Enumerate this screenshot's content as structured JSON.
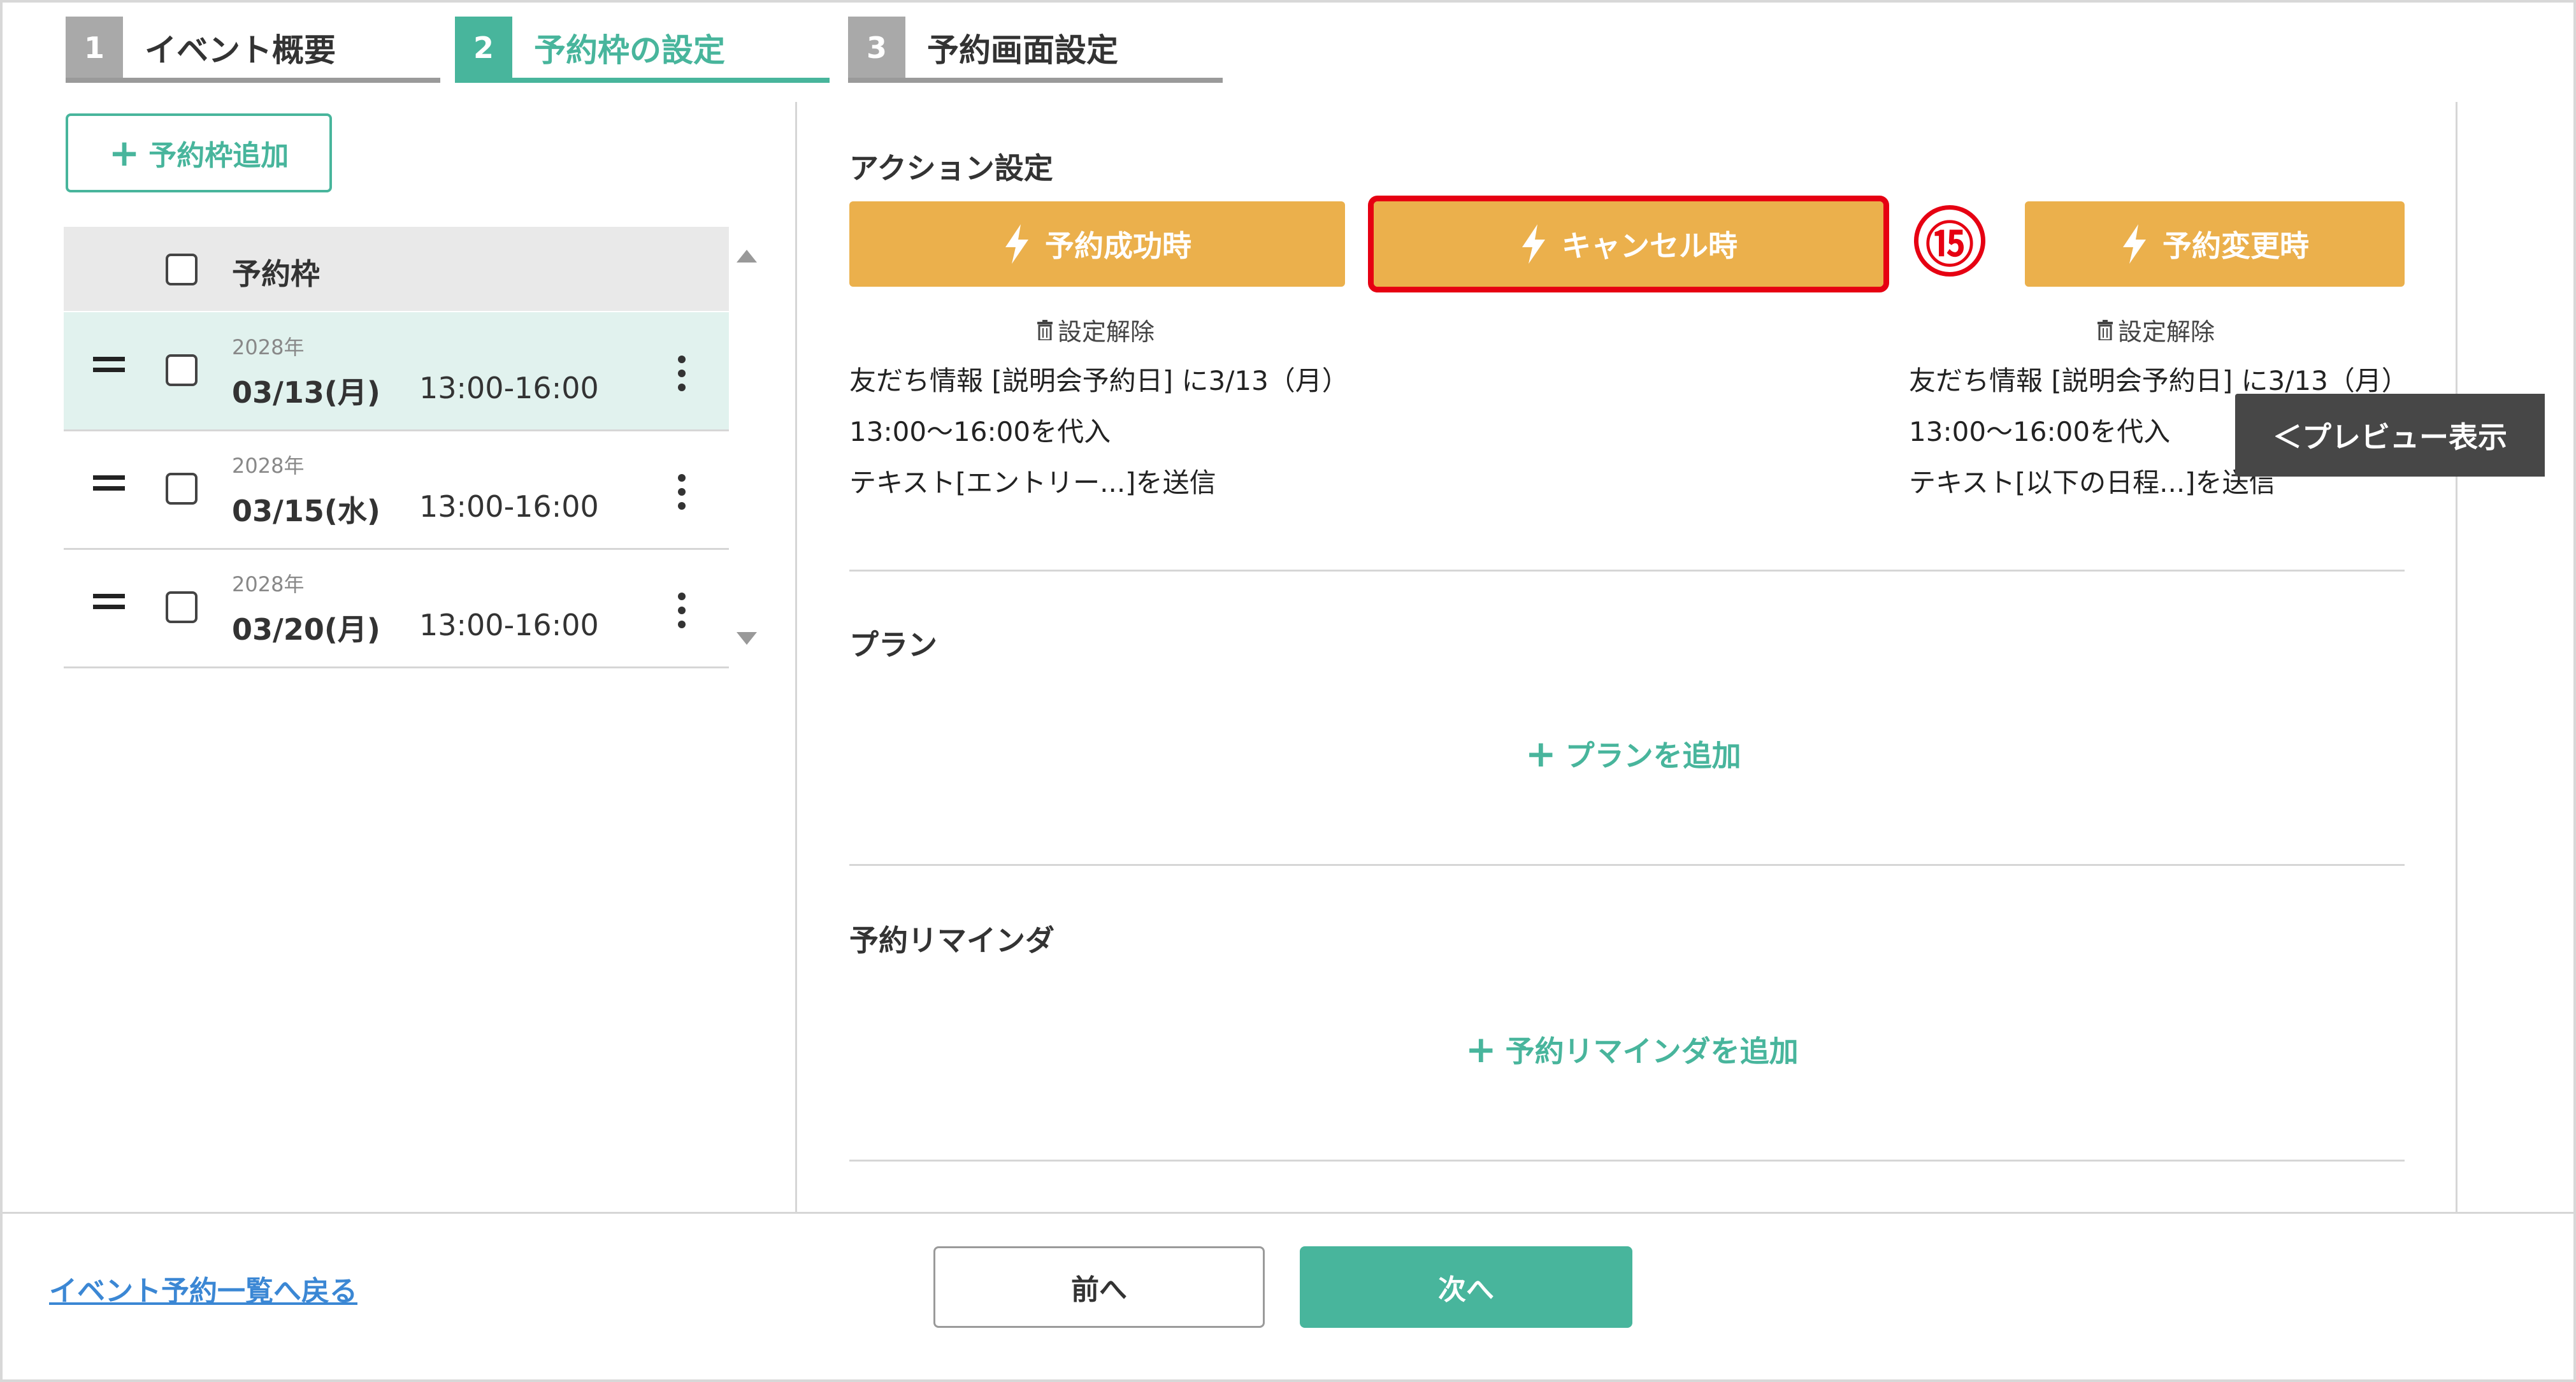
{
  "steps": [
    {
      "num": "1",
      "label": "イベント概要"
    },
    {
      "num": "2",
      "label": "予約枠の設定"
    },
    {
      "num": "3",
      "label": "予約画面設定"
    }
  ],
  "sidebar": {
    "add_slot_label": "予約枠追加",
    "list_header": "予約枠",
    "slots": [
      {
        "year": "2028年",
        "date": "03/13(月)",
        "time": "13:00-16:00"
      },
      {
        "year": "2028年",
        "date": "03/15(水)",
        "time": "13:00-16:00"
      },
      {
        "year": "2028年",
        "date": "03/20(月)",
        "time": "13:00-16:00"
      }
    ]
  },
  "actions": {
    "title": "アクション設定",
    "success_label": "予約成功時",
    "cancel_label": "キャンセル時",
    "change_label": "予約変更時",
    "annotation": "⑮",
    "unset_label": "設定解除",
    "success_desc": [
      "友だち情報 [説明会予約日] に3/13（月）",
      "13:00〜16:00を代入",
      "テキスト[エントリー...]を送信"
    ],
    "change_desc": [
      "友だち情報 [説明会予約日] に3/13（月）",
      "13:00〜16:00を代入",
      "テキスト[以下の日程...]を送信"
    ]
  },
  "plan": {
    "title": "プラン",
    "add_label": "プランを追加"
  },
  "reminder": {
    "title": "予約リマインダ",
    "add_label": "予約リマインダを追加"
  },
  "preview_label": "＜プレビュー表示",
  "footer": {
    "back_link": "イベント予約一覧へ戻る",
    "prev_label": "前へ",
    "next_label": "次へ"
  },
  "colors": {
    "accent": "#48b59c",
    "action": "#ebb04c",
    "highlight": "#e60012",
    "link": "#3b87d4"
  }
}
